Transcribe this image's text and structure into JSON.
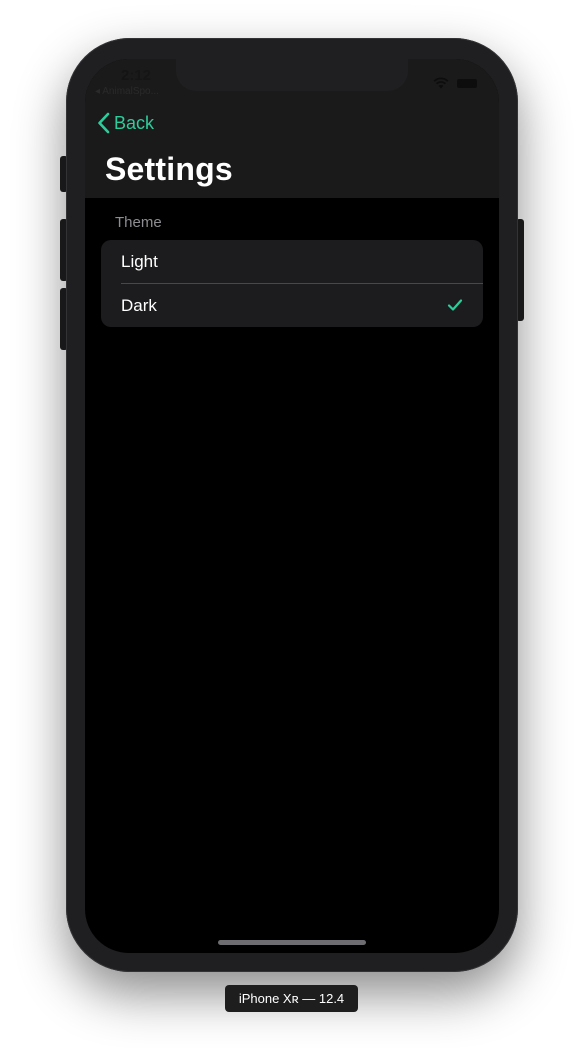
{
  "status_bar": {
    "time": "2:12",
    "return_app": "◂ AnimalSpo..."
  },
  "nav": {
    "back_label": "Back",
    "title": "Settings"
  },
  "theme_section": {
    "header": "Theme",
    "options": [
      {
        "label": "Light",
        "selected": false
      },
      {
        "label": "Dark",
        "selected": true
      }
    ]
  },
  "simulator": {
    "device_label": "iPhone Xʀ — 12.4"
  },
  "colors": {
    "accent": "#2ecc9a",
    "background": "#000000",
    "nav_background": "#1a1a1a",
    "cell_background": "#1c1c1e"
  },
  "icons": [
    "chevron-left-icon",
    "checkmark-icon",
    "wifi-icon",
    "battery-icon"
  ]
}
